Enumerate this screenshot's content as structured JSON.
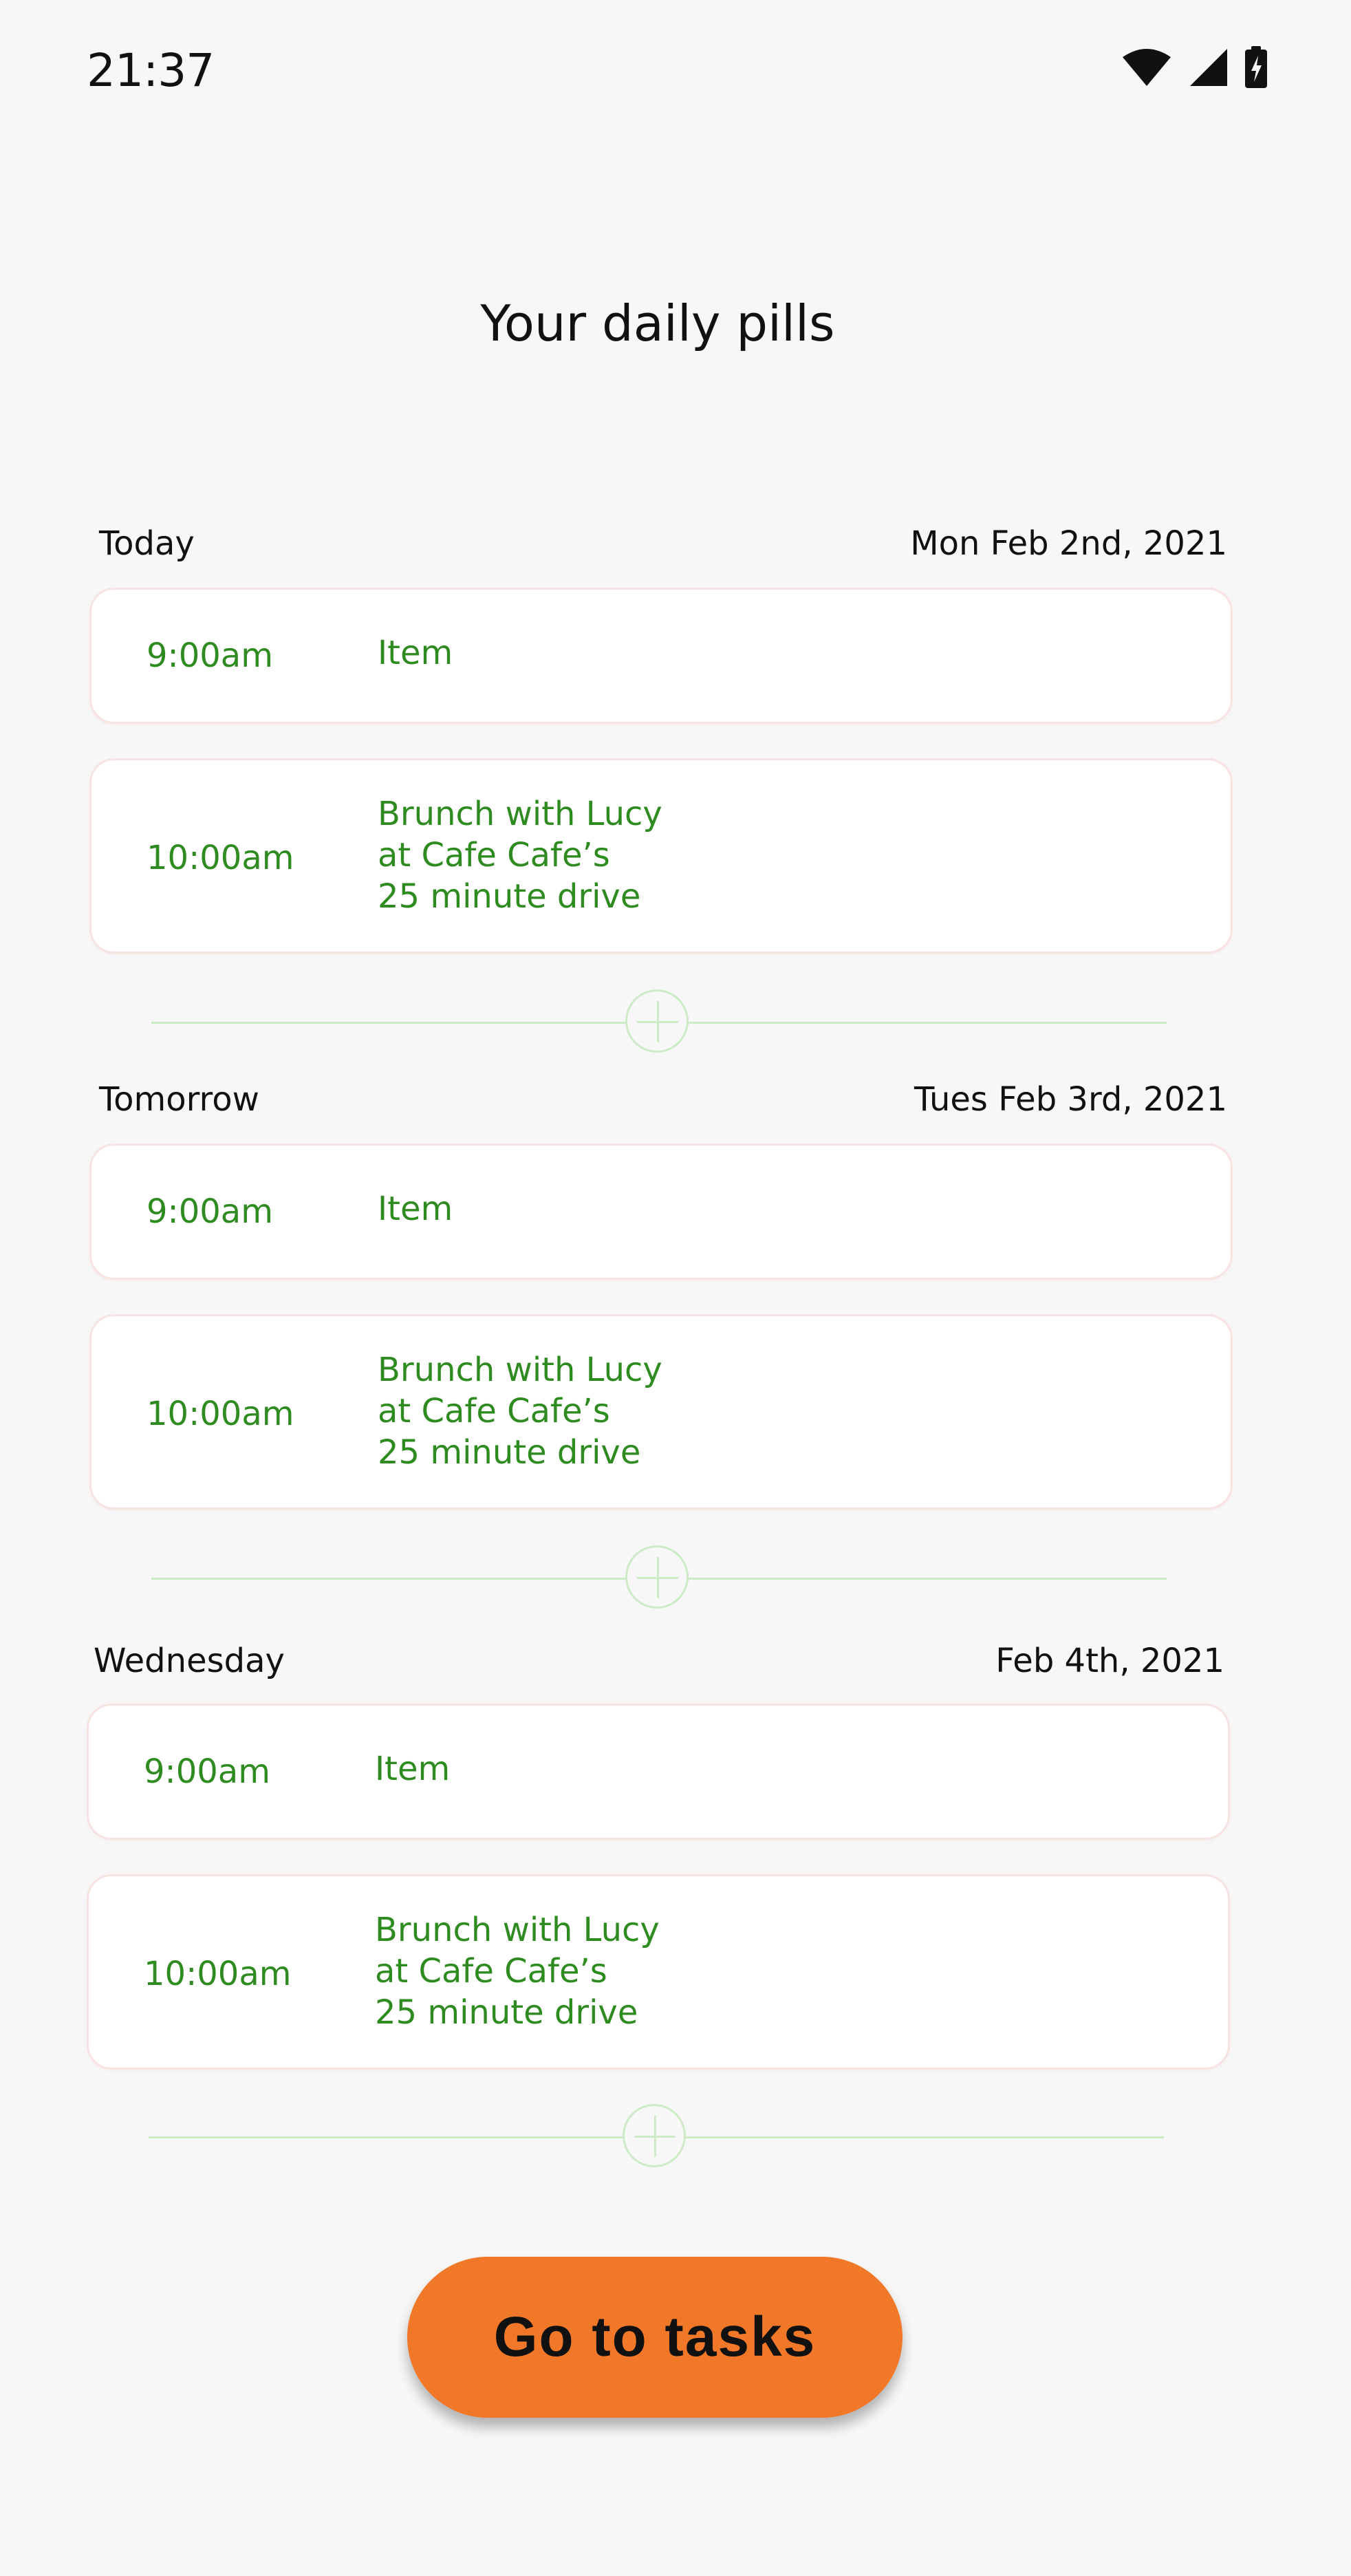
{
  "status_bar": {
    "time": "21:37",
    "icons": [
      "wifi-icon",
      "cell-signal-icon",
      "battery-charging-icon"
    ]
  },
  "page": {
    "title": "Your daily pills"
  },
  "days": [
    {
      "label": "Today",
      "date": "Mon Feb 2nd, 2021",
      "items": [
        {
          "time": "9:00am",
          "lines": [
            "Item"
          ]
        },
        {
          "time": "10:00am",
          "lines": [
            "Brunch with Lucy",
            "at Cafe Cafe’s",
            "25 minute drive"
          ]
        }
      ]
    },
    {
      "label": "Tomorrow",
      "date": "Tues Feb 3rd, 2021",
      "items": [
        {
          "time": "9:00am",
          "lines": [
            "Item"
          ]
        },
        {
          "time": "10:00am",
          "lines": [
            "Brunch with Lucy",
            "at Cafe Cafe’s",
            "25 minute drive"
          ]
        }
      ]
    },
    {
      "label": "Wednesday",
      "date": "Feb 4th, 2021",
      "items": [
        {
          "time": "9:00am",
          "lines": [
            "Item"
          ]
        },
        {
          "time": "10:00am",
          "lines": [
            "Brunch with Lucy",
            "at Cafe Cafe’s",
            "25 minute drive"
          ]
        }
      ]
    }
  ],
  "actions": {
    "go_to_tasks_label": "Go to tasks"
  },
  "colors": {
    "accent_green": "#2e8b1f",
    "divider_green": "#cfeac9",
    "cta_orange": "#f27829",
    "background": "#f7f7f7"
  }
}
